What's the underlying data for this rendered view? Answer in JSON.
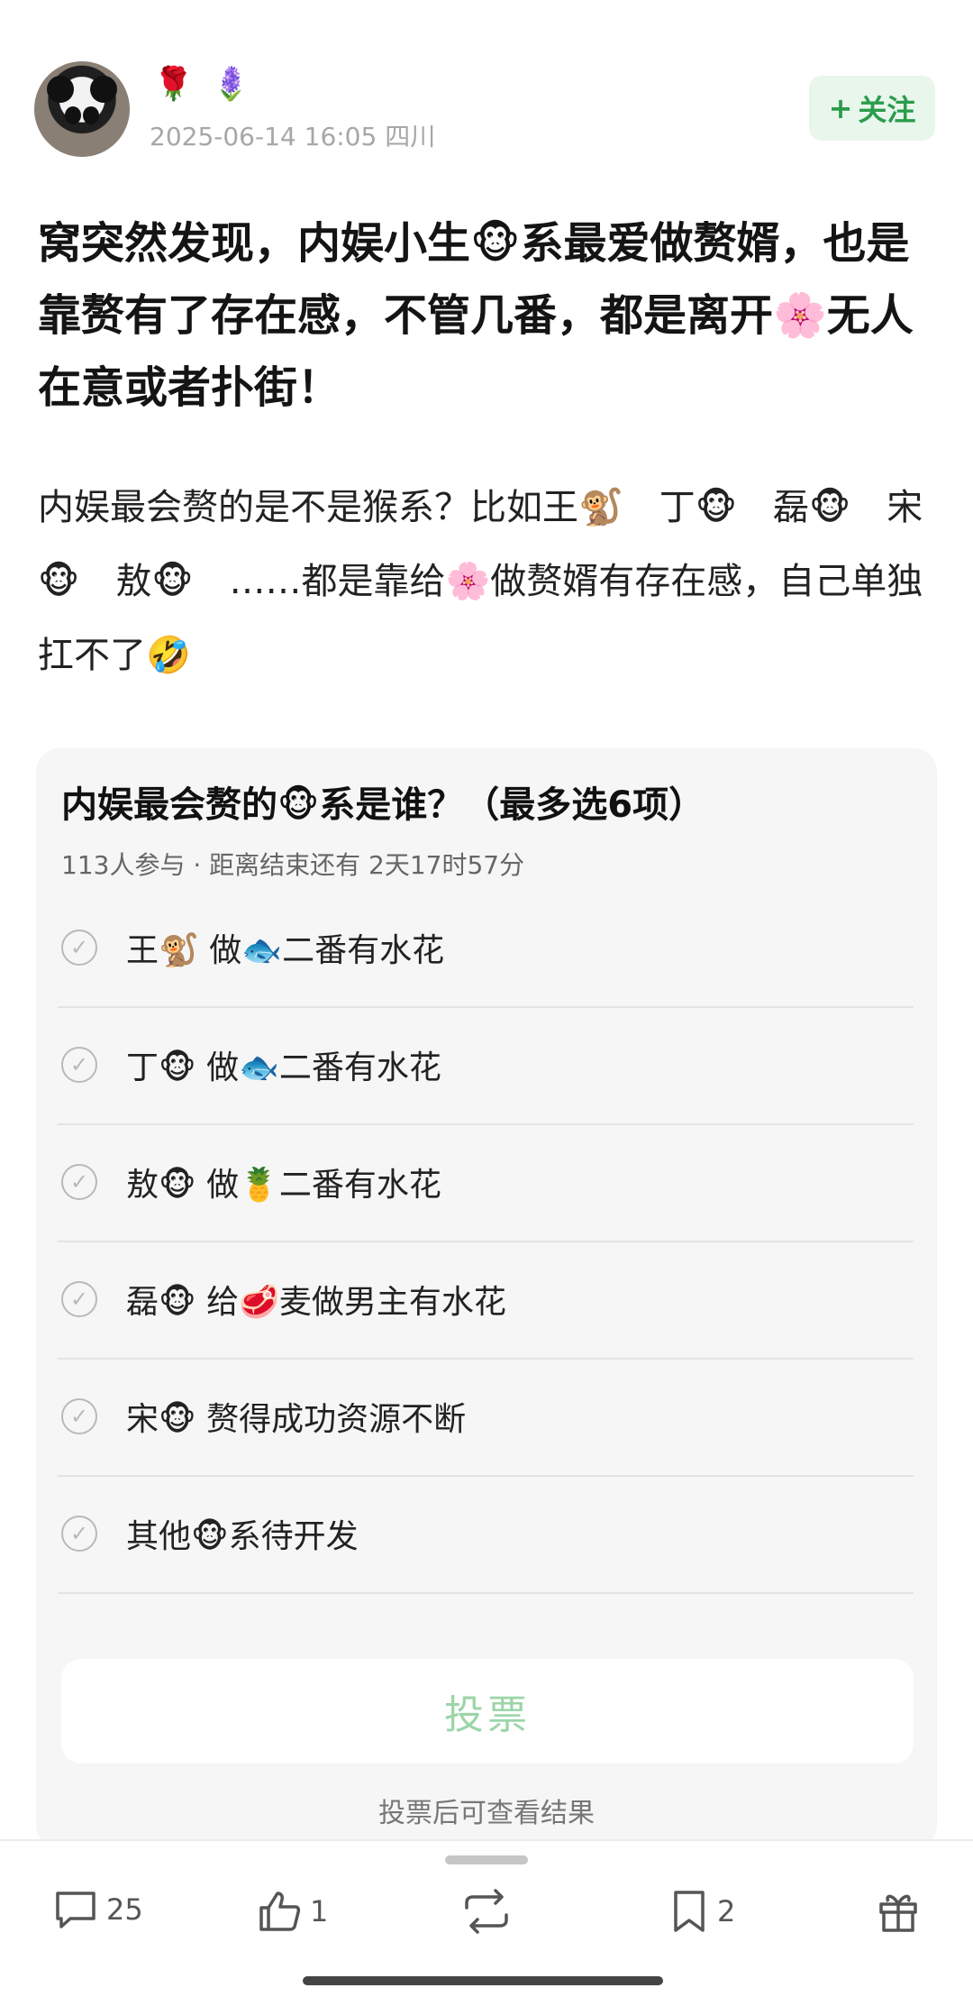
{
  "header": {
    "avatar_icon": "panda-avatar",
    "badges": "🌹 🪻",
    "meta": "2025-06-14 16:05  四川",
    "follow_label": "关注"
  },
  "post": {
    "title": "窝突然发现，内娱小生🐵系最爱做赘婿，也是靠赘有了存在感，不管几番，都是离开🌸无人在意或者扑街！",
    "body": "内娱最会赘的是不是猴系？比如王🐒　丁🐵　磊🐵　宋🐵　敖🐵　……都是靠给🌸做赘婿有存在感，自己单独扛不了🤣"
  },
  "poll": {
    "question": "内娱最会赘的🐵系是谁？（最多选6项）",
    "info": "113人参与 · 距离结束还有 2天17时57分",
    "options": [
      "王🐒 做🐟二番有水花",
      "丁🐵 做🐟二番有水花",
      "敖🐵 做🍍二番有水花",
      "磊🐵 给🥩麦做男主有水花",
      "宋🐵 赘得成功资源不断",
      "其他🐵系待开发"
    ],
    "vote_label": "投票",
    "note": "投票后可查看结果"
  },
  "actions": {
    "comments": "25",
    "likes": "1",
    "bookmarks": "2"
  },
  "colors": {
    "accent_green": "#2a9c4b",
    "follow_bg": "#e9f6ec",
    "vote_text": "#9bd5a8"
  }
}
